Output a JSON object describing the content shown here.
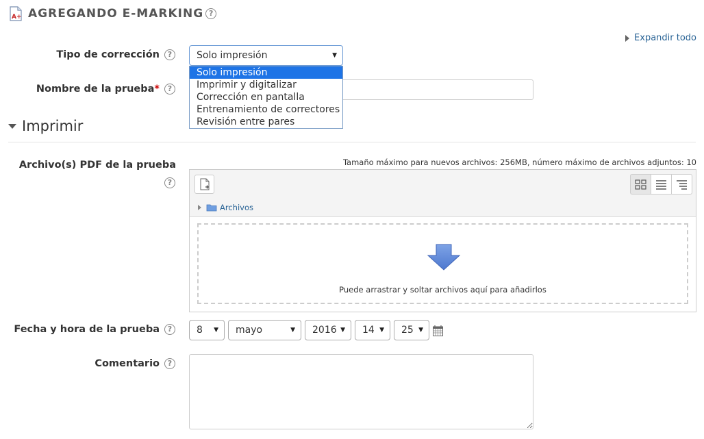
{
  "header": {
    "title": "AGREGANDO E-MARKING"
  },
  "expand_all": "Expandir todo",
  "tipo_correccion": {
    "label": "Tipo de corrección",
    "selected": "Solo impresión",
    "options": [
      "Solo impresión",
      "Imprimir y digitalizar",
      "Corrección en pantalla",
      "Entrenamiento de correctores",
      "Revisión entre pares"
    ]
  },
  "nombre_prueba": {
    "label": "Nombre de la prueba",
    "required_mark": "*",
    "value": ""
  },
  "section": {
    "title": "Imprimir"
  },
  "archivos": {
    "label": "Archivo(s) PDF de la prueba",
    "limits": "Tamaño máximo para nuevos archivos: 256MB, número máximo de archivos adjuntos: 10",
    "folder": "Archivos",
    "drop_message": "Puede arrastrar y soltar archivos aquí para añadirlos"
  },
  "fecha": {
    "label": "Fecha y hora de la prueba",
    "day": "8",
    "month": "mayo",
    "year": "2016",
    "hour": "14",
    "minute": "25"
  },
  "comentario": {
    "label": "Comentario",
    "value": ""
  },
  "colors": {
    "link": "#2a6496",
    "highlight": "#1e74e6",
    "required": "#cc0000",
    "arrow": "#5b86d4"
  }
}
